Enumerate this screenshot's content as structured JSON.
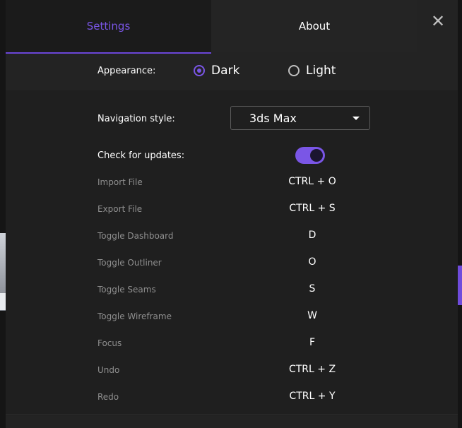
{
  "tabs": [
    {
      "label": "Settings",
      "active": true
    },
    {
      "label": "About",
      "active": false
    }
  ],
  "close": {
    "icon": "close-icon",
    "glyph": "✕"
  },
  "appearance": {
    "label": "Appearance:",
    "options": [
      {
        "label": "Dark",
        "selected": true
      },
      {
        "label": "Light",
        "selected": false
      }
    ]
  },
  "navigation": {
    "label": "Navigation style:",
    "value": "3ds Max"
  },
  "updates": {
    "label": "Check for updates:",
    "enabled": true
  },
  "shortcuts": [
    {
      "name": "Import File",
      "key": "CTRL + O"
    },
    {
      "name": "Export File",
      "key": "CTRL + S"
    },
    {
      "name": "Toggle Dashboard",
      "key": "D"
    },
    {
      "name": "Toggle Outliner",
      "key": "O"
    },
    {
      "name": "Toggle Seams",
      "key": "S"
    },
    {
      "name": "Toggle Wireframe",
      "key": "W"
    },
    {
      "name": "Focus",
      "key": "F"
    },
    {
      "name": "Undo",
      "key": "CTRL + Z"
    },
    {
      "name": "Redo",
      "key": "CTRL + Y"
    }
  ],
  "colors": {
    "accent": "#7a56e6",
    "panel": "#232323",
    "content": "#1f1f1f"
  }
}
